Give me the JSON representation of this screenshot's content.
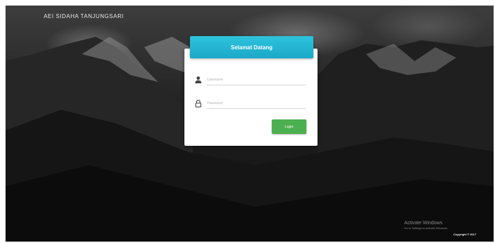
{
  "brand": {
    "title": "AEI SIDAHA TANJUNGSARI"
  },
  "login": {
    "header": "Selamat Datang",
    "username_placeholder": "Username",
    "password_placeholder": "Password",
    "submit_label": "Login",
    "header_color": "#1fb3d2",
    "button_color": "#4caf50"
  },
  "icons": {
    "username": "user-icon",
    "password": "lock-icon"
  },
  "watermark": {
    "title": "Activate Windows",
    "subtitle": "Go to Settings to activate Windows."
  },
  "footer": {
    "copyright": "Copyright © 2017"
  }
}
